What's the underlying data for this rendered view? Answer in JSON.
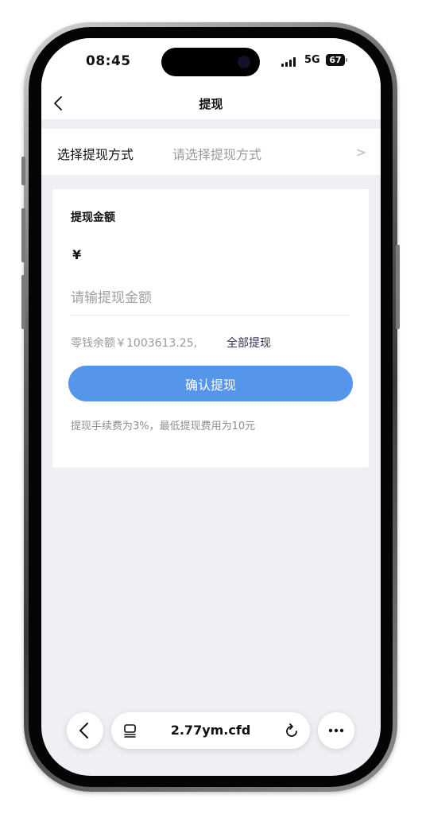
{
  "status": {
    "time": "08:45",
    "network": "5G",
    "battery": "67"
  },
  "nav": {
    "title": "提现"
  },
  "method": {
    "label": "选择提现方式",
    "placeholder": "请选择提现方式"
  },
  "card": {
    "title": "提现金额",
    "currency": "¥",
    "amount_placeholder": "请输提现金额",
    "balance_text": "零钱余额￥1003613.25,",
    "withdraw_all": "全部提现",
    "confirm_label": "确认提现",
    "fee_note": "提现手续费为3%，最低提现费用为10元"
  },
  "browser": {
    "url": "2.77ym.cfd"
  },
  "colors": {
    "accent": "#5596ea",
    "page_background": "#efeff4"
  },
  "icons": {
    "back": "chevron-left-icon",
    "method_chevron": "chevron-right-icon",
    "reader": "reader-mode-icon",
    "reload": "reload-icon",
    "more": "more-icon"
  }
}
